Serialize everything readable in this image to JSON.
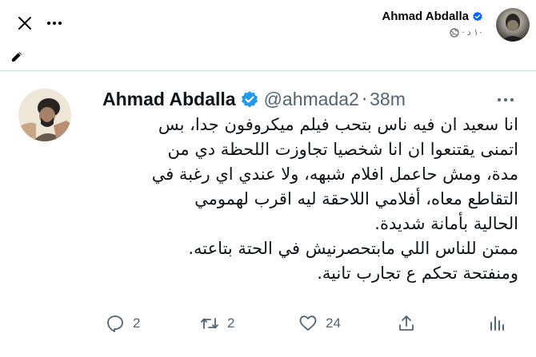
{
  "facebook_header": {
    "author_name": "Ahmad Abdalla",
    "post_time": "١٠ د",
    "icons": {
      "close": "close-icon",
      "more": "more-horizontal-icon",
      "edit": "edit-pen-icon",
      "privacy": "globe-icon",
      "verified": "verified-badge-icon"
    },
    "colors": {
      "verified": "#0866ff",
      "meta_text": "#65676b"
    }
  },
  "tweet": {
    "name": "Ahmad Abdalla",
    "handle": "@ahmada2",
    "separator": "·",
    "time": "38m",
    "text_lines": [
      "انا سعيد ان فيه ناس بتحب فيلم ميكروفون جدا، بس",
      "اتمنى يقتنعوا ان انا شخصيا تجاوزت اللحظة دي من",
      "مدة، ومش حاعمل افلام شبهه، ولا عندي اي رغبة في",
      "التقاطع معاه، أفلامي اللاحقة ليه اقرب لهمومي",
      "الحالية بأمانة شديدة.",
      "ممتن للناس اللي مابتحصرنيش في الحتة بتاعته.",
      "ومنفتحة تحكم ع تجارب تانية."
    ],
    "colors": {
      "verified": "#1d9bf0",
      "secondary_text": "#536471",
      "text": "#0f1419"
    }
  },
  "actions": {
    "reply_count": "2",
    "retweet_count": "2",
    "like_count": "24",
    "icons": [
      "reply-icon",
      "retweet-icon",
      "like-icon",
      "share-icon",
      "analytics-icon"
    ]
  }
}
